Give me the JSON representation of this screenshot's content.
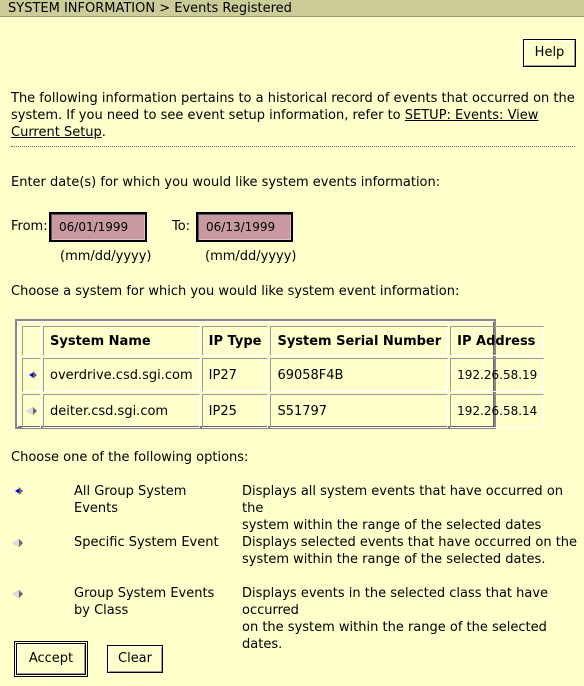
{
  "header": {
    "title": "SYSTEM INFORMATION > Events Registered"
  },
  "toolbar": {
    "help_label": "Help"
  },
  "intro": {
    "text": "The following information pertains to a historical record of events that occurred on the system. If you need to see event setup information, refer to ",
    "link_text": "SETUP: Events: View Current Setup",
    "suffix": "."
  },
  "dates": {
    "prompt": "Enter date(s) for which you would like system events information:",
    "from_label": "From:",
    "from_value": "06/01/1999",
    "to_label": "To:",
    "to_value": "06/13/1999",
    "format_hint_from": "(mm/dd/yyyy)",
    "format_hint_to": "(mm/dd/yyyy)"
  },
  "systems": {
    "prompt": "Choose a system for which you would like system event information:",
    "columns": [
      "System Name",
      "IP Type",
      "System Serial Number",
      "IP Address"
    ],
    "rows": [
      {
        "name": "overdrive.csd.sgi.com",
        "ip_type": "IP27",
        "serial": "69058F4B",
        "ip": "192.26.58.19",
        "selected": true
      },
      {
        "name": "deiter.csd.sgi.com",
        "ip_type": "IP25",
        "serial": "S51797",
        "ip": "192.26.58.14",
        "selected": false
      }
    ]
  },
  "options": {
    "prompt": "Choose one of the following options:",
    "items": [
      {
        "label_line1": "All Group System",
        "label_line2": "Events",
        "desc_line1": "Displays all system events that have occurred on the",
        "desc_line2": "system within the range of the selected dates",
        "selected": true
      },
      {
        "label_line1": "Specific System Event",
        "label_line2": "",
        "desc_line1": "Displays selected events that have occurred on the",
        "desc_line2": "system within the range of the selected dates.",
        "selected": false
      },
      {
        "label_line1": "Group System Events",
        "label_line2": "by Class",
        "desc_line1": "Displays events in the selected class that have occurred",
        "desc_line2": "on the system within the range of the selected dates.",
        "selected": false
      }
    ]
  },
  "actions": {
    "accept_label": "Accept",
    "clear_label": "Clear"
  },
  "colors": {
    "background": "#ffffcc",
    "titlebar": "#cccc99",
    "date_field": "#c89aa0",
    "radio_selected": "#0000cc"
  },
  "icons": {
    "radio": "diamond-radio-icon"
  }
}
